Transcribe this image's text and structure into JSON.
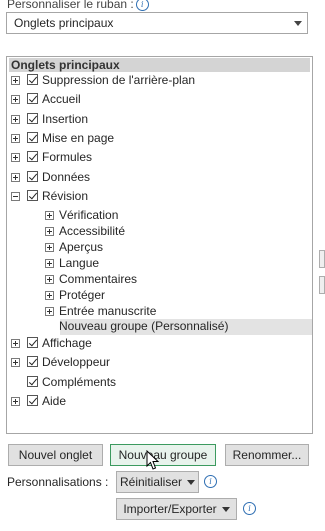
{
  "ribbon": {
    "label": "Personnaliser le ruban :",
    "combo_value": "Onglets principaux"
  },
  "tree": {
    "header": "Onglets principaux",
    "items": [
      {
        "label": "Suppression de l'arrière-plan",
        "checked": true,
        "expander": "plus"
      },
      {
        "label": "Accueil",
        "checked": true,
        "expander": "plus"
      },
      {
        "label": "Insertion",
        "checked": true,
        "expander": "plus"
      },
      {
        "label": "Mise en page",
        "checked": true,
        "expander": "plus"
      },
      {
        "label": "Formules",
        "checked": true,
        "expander": "plus"
      },
      {
        "label": "Données",
        "checked": true,
        "expander": "plus"
      },
      {
        "label": "Révision",
        "checked": true,
        "expander": "minus"
      }
    ],
    "revision_children": [
      "Vérification",
      "Accessibilité",
      "Aperçus",
      "Langue",
      "Commentaires",
      "Protéger",
      "Entrée manuscrite"
    ],
    "new_group": "Nouveau groupe (Personnalisé)",
    "items_after": [
      {
        "label": "Affichage",
        "checked": true,
        "expander": "plus"
      },
      {
        "label": "Développeur",
        "checked": true,
        "expander": "plus"
      },
      {
        "label": "Compléments",
        "checked": true,
        "expander": "none"
      },
      {
        "label": "Aide",
        "checked": true,
        "expander": "plus"
      }
    ]
  },
  "buttons": {
    "new_tab": "Nouvel onglet",
    "new_group": "Nouveau groupe",
    "rename": "Renommer..."
  },
  "customizations": {
    "label": "Personnalisations :",
    "reset": "Réinitialiser",
    "import_export": "Importer/Exporter"
  }
}
